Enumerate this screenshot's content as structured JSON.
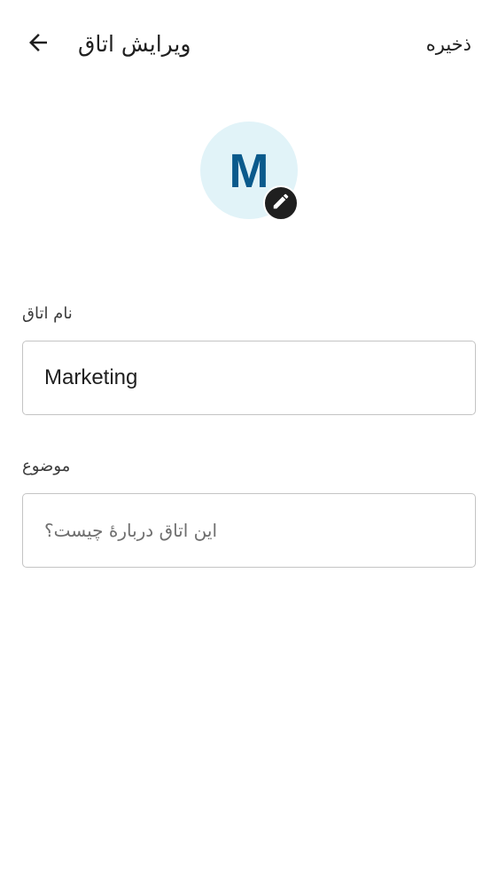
{
  "header": {
    "title": "ویرایش اتاق",
    "save_label": "ذخیره",
    "back_icon": "arrow-back-icon"
  },
  "avatar": {
    "letter": "M",
    "background_color": "#e1f3f8",
    "letter_color": "#0a5a8c",
    "edit_icon": "pencil-icon"
  },
  "form": {
    "name": {
      "label": "نام اتاق",
      "value": "Marketing"
    },
    "topic": {
      "label": "موضوع",
      "value": "",
      "placeholder": "این اتاق دربارهٔ چیست؟"
    }
  }
}
